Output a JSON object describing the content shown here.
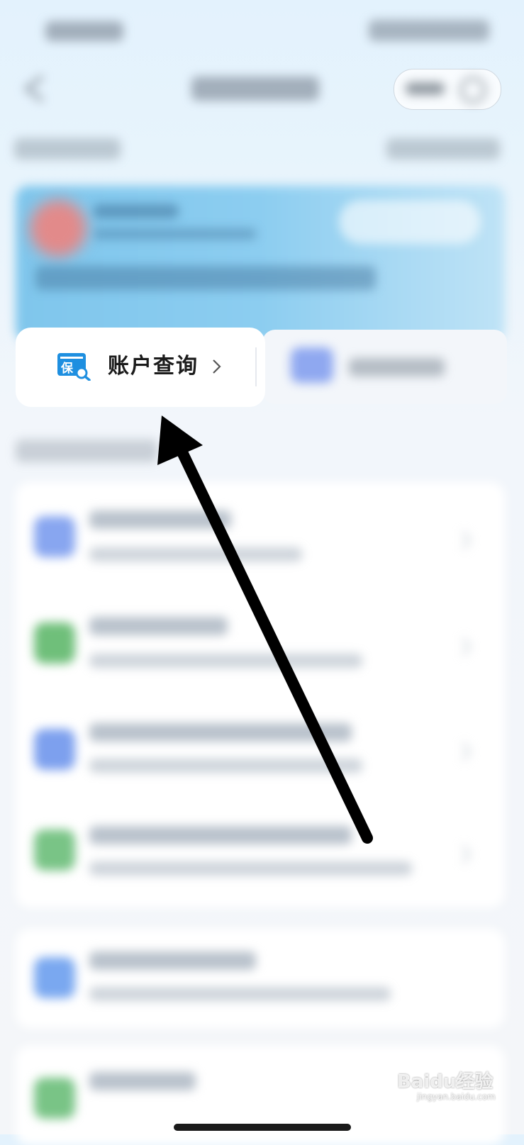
{
  "account_query": {
    "label": "账户查询",
    "icon_char": "保"
  },
  "watermark": {
    "brand": "Baidu经验",
    "url": "jingyan.baidu.com"
  },
  "colors": {
    "brand_blue": "#1e8fe0",
    "arrow": "#000000",
    "card_blue": "#8ccdf0"
  }
}
